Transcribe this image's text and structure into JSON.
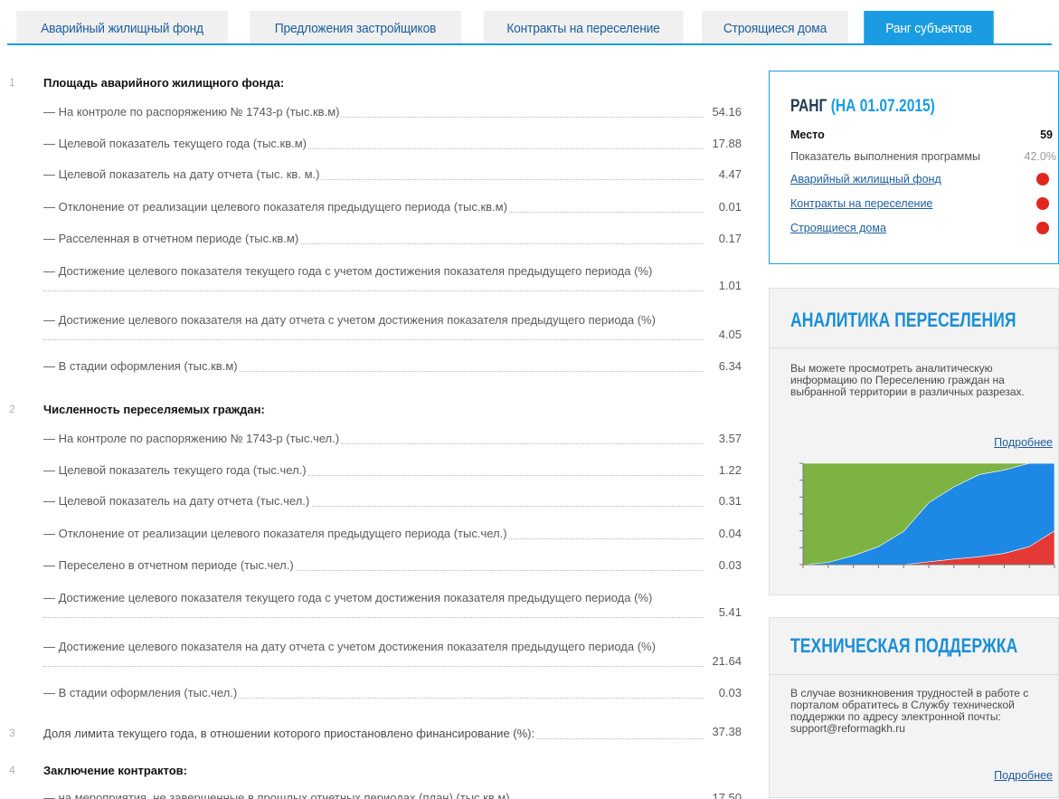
{
  "tabs": [
    {
      "label": "Аварийный жилищный фонд",
      "active": false
    },
    {
      "label": "Предложения застройщиков",
      "active": false
    },
    {
      "label": "Контракты на переселение",
      "active": false
    },
    {
      "label": "Строящиеся дома",
      "active": false
    },
    {
      "label": "Ранг субъектов",
      "active": true
    }
  ],
  "sections": [
    {
      "num": "1",
      "title": "Площадь аварийного жилищного фонда:",
      "rows": [
        {
          "label": "— На контроле по распоряжению № 1743-р (тыс.кв.м)",
          "value": "54.16"
        },
        {
          "label": "— Целевой показатель текущего года (тыс.кв.м)",
          "value": "17.88"
        },
        {
          "label": "— Целевой показатель на дату отчета (тыс. кв. м.)",
          "value": "4.47"
        },
        {
          "label": "— Отклонение от реализации целевого показателя предыдущего периода (тыс.кв.м)",
          "value": "0.01"
        },
        {
          "label": "— Расселенная в отчетном периоде (тыс.кв.м)",
          "value": "0.17"
        },
        {
          "label": "— Достижение целевого показателя текущего года с учетом достижения показателя предыдущего периода (%)",
          "value": "1.01"
        },
        {
          "label": "— Достижение целевого показателя на дату отчета с учетом достижения показателя предыдущего периода (%)",
          "value": "4.05"
        },
        {
          "label": "— В стадии оформления (тыс.кв.м)",
          "value": "6.34"
        }
      ]
    },
    {
      "num": "2",
      "title": "Численность переселяемых граждан:",
      "rows": [
        {
          "label": "— На контроле по распоряжению № 1743-р (тыс.чел.)",
          "value": "3.57"
        },
        {
          "label": "— Целевой показатель текущего года (тыс.чел.)",
          "value": "1.22"
        },
        {
          "label": "— Целевой показатель на дату отчета (тыс.чел.)",
          "value": "0.31"
        },
        {
          "label": "— Отклонение от реализации целевого показателя предыдущего периода (тыс.чел.)",
          "value": "0.04"
        },
        {
          "label": "— Переселено в отчетном периоде (тыс.чел.)",
          "value": "0.03"
        },
        {
          "label": "— Достижение целевого показателя текущего года с учетом достижения показателя предыдущего периода (%)",
          "value": "5.41"
        },
        {
          "label": "— Достижение целевого показателя на дату отчета с учетом достижения показателя предыдущего периода (%)",
          "value": "21.64"
        },
        {
          "label": "— В стадии оформления (тыс.чел.)",
          "value": "0.03"
        }
      ]
    },
    {
      "num": "3",
      "title": "Доля лимита текущего года, в отношении которого приостановлено финансирование (%):",
      "value": "37.38"
    },
    {
      "num": "4",
      "title": "Заключение контрактов:",
      "rows": [
        {
          "label": "— на мероприятия, не завершенные в прошлых отчетных периодах (план) (тыс.кв.м)",
          "value": "17.50"
        }
      ]
    }
  ],
  "rank": {
    "title": "РАНГ",
    "date": "(НА 01.07.2015)",
    "place_label": "Место",
    "place_value": "59",
    "progress_label": "Показатель выполнения программы",
    "progress_value": "42.0%",
    "links": [
      {
        "label": "Аварийный жилищный фонд",
        "status_color": "#e0261f"
      },
      {
        "label": "Контракты на переселение",
        "status_color": "#e0261f"
      },
      {
        "label": "Строящиеся дома",
        "status_color": "#e0261f"
      }
    ]
  },
  "analytics": {
    "title": "АНАЛИТИКА ПЕРЕСЕЛЕНИЯ",
    "text": "Вы можете просмотреть аналитическую информацию по Переселению граждан на выбранной территории в различных разрезах.",
    "more": "Подробнее"
  },
  "support": {
    "title": "ТЕХНИЧЕСКАЯ ПОДДЕРЖКА",
    "text": "В случае возникновения трудностей в работе с порталом обратитесь в Службу технической поддержки по адресу электронной почты: support@reformagkh.ru",
    "more": "Подробнее"
  },
  "chart_data": {
    "type": "area",
    "stacked": true,
    "x": [
      0,
      1,
      2,
      3,
      4,
      5,
      6,
      7,
      8,
      9,
      10
    ],
    "series": [
      {
        "color": "#e53935",
        "values": [
          0,
          0,
          0,
          0,
          0,
          0.5,
          1.0,
          1.4,
          2.0,
          3.2,
          6.0
        ]
      },
      {
        "color": "#1e88e5",
        "values": [
          0,
          0.4,
          1.6,
          3.2,
          5.9,
          10.5,
          12.8,
          14.6,
          14.8,
          14.8,
          12.0
        ]
      },
      {
        "color": "#7cb342",
        "values": [
          18,
          17.6,
          16.4,
          14.8,
          12.1,
          7.0,
          4.2,
          2.0,
          1.2,
          0,
          0
        ]
      }
    ],
    "ylim": [
      0,
      18
    ],
    "grid": false,
    "legend": "none"
  },
  "colors": {
    "accent": "#1a9ce3",
    "link": "#1d5d9e",
    "status_red": "#e0261f"
  }
}
